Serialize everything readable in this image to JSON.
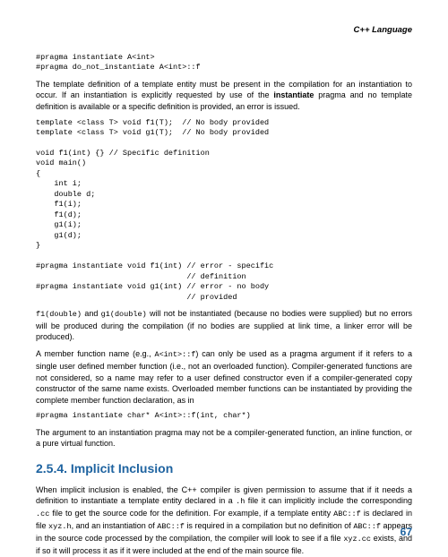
{
  "header": {
    "title": "C++ Language"
  },
  "code_block_1": "#pragma instantiate A<int>\n#pragma do_not_instantiate A<int>::f",
  "para_1_pre": "The template definition of a template entity must be present in the compilation for an instantiation to occur. If an instantiation is explicitly requested by use of the ",
  "para_1_bold": "instantiate",
  "para_1_post": " pragma and no template definition is available or a specific definition is provided, an error is issued.",
  "code_block_2": "template <class T> void f1(T);  // No body provided\ntemplate <class T> void g1(T);  // No body provided\n\nvoid f1(int) {} // Specific definition\nvoid main()\n{\n    int i;\n    double d;\n    f1(i);\n    f1(d);\n    g1(i);\n    g1(d);\n}\n\n#pragma instantiate void f1(int) // error - specific\n                                 // definition\n#pragma instantiate void g1(int) // error - no body\n                                 // provided",
  "para_2_code1": "f1(double)",
  "para_2_text1": " and ",
  "para_2_code2": "g1(double)",
  "para_2_text2": " will not be instantiated (because no bodies were supplied) but no errors will be produced during the compilation (if no bodies are supplied at link time, a linker error will be produced).",
  "para_3_text1": "A member function name (e.g., ",
  "para_3_code1": "A<int>::f",
  "para_3_text2": ") can only be used as a pragma argument if it refers to a single user defined member function (i.e., not an overloaded function). Compiler-generated functions are not considered, so a name may refer to a user defined constructor even if a compiler-generated copy constructor of the same name exists. Overloaded member functions can be instantiated by providing the complete member function declaration, as in",
  "code_block_3": "#pragma instantiate char* A<int>::f(int, char*)",
  "para_4": "The argument to an instantiation pragma may not be a compiler-generated function, an inline function, or a pure virtual function.",
  "section_heading": "2.5.4. Implicit Inclusion",
  "para_5_text1": "When implicit inclusion is enabled, the C++ compiler is given permission to assume that if it needs a definition to instantiate a template entity declared in a ",
  "para_5_code1": ".h",
  "para_5_text2": " file it can implicitly include the corresponding ",
  "para_5_code2": ".cc",
  "para_5_text3": " file to get the source code for the definition. For example, if a template entity ",
  "para_5_code3": "ABC::f",
  "para_5_text4": " is declared in file ",
  "para_5_code4": "xyz.h",
  "para_5_text5": ", and an instantiation of ",
  "para_5_code5": "ABC::f",
  "para_5_text6": " is required in a compilation but no definition of ",
  "para_5_code6": "ABC::f",
  "para_5_text7": " appears in the source code processed by the compilation, the compiler will look to see if a file ",
  "para_5_code7": "xyz.cc",
  "para_5_text8": " exists, and if so it will process it as if it were included at the end of the main source file.",
  "page_number": "67"
}
